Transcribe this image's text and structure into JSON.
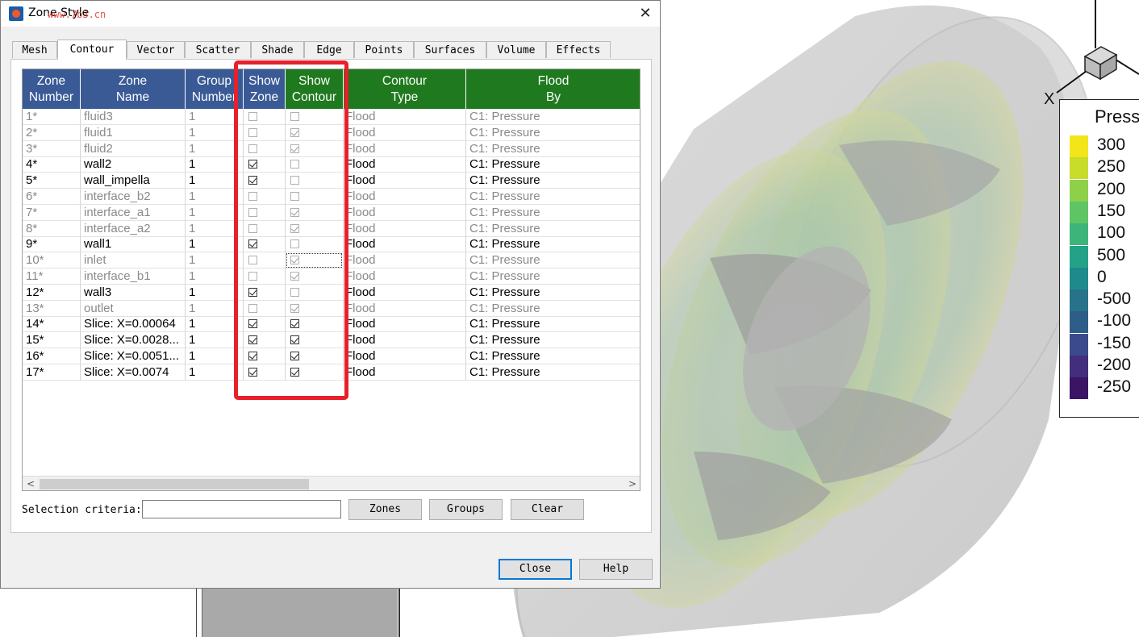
{
  "dialog": {
    "title": "Zone Style",
    "watermark": "www.7b3.cn",
    "close_glyph": "✕"
  },
  "tabs": [
    {
      "label": "Mesh",
      "active": false
    },
    {
      "label": "Contour",
      "active": true
    },
    {
      "label": "Vector",
      "active": false
    },
    {
      "label": "Scatter",
      "active": false
    },
    {
      "label": "Shade",
      "active": false
    },
    {
      "label": "Edge",
      "active": false
    },
    {
      "label": "Points",
      "active": false
    },
    {
      "label": "Surfaces",
      "active": false
    },
    {
      "label": "Volume",
      "active": false
    },
    {
      "label": "Effects",
      "active": false
    }
  ],
  "grid": {
    "headers": {
      "zone_number": [
        "Zone",
        "Number"
      ],
      "zone_name": [
        "Zone",
        "Name"
      ],
      "group_number": [
        "Group",
        "Number"
      ],
      "show_zone": [
        "Show",
        "Zone"
      ],
      "show_contour": [
        "Show",
        "Contour"
      ],
      "contour_type": [
        "Contour",
        "Type"
      ],
      "flood_by": [
        "Flood",
        "By"
      ]
    },
    "rows": [
      {
        "num": "1*",
        "name": "fluid3",
        "group": "1",
        "show_zone": false,
        "show_contour": false,
        "type": "Flood",
        "flood_by": "C1: Pressure",
        "active": false
      },
      {
        "num": "2*",
        "name": "fluid1",
        "group": "1",
        "show_zone": false,
        "show_contour": true,
        "type": "Flood",
        "flood_by": "C1: Pressure",
        "active": false
      },
      {
        "num": "3*",
        "name": "fluid2",
        "group": "1",
        "show_zone": false,
        "show_contour": true,
        "type": "Flood",
        "flood_by": "C1: Pressure",
        "active": false
      },
      {
        "num": "4*",
        "name": "wall2",
        "group": "1",
        "show_zone": true,
        "show_contour": false,
        "type": "Flood",
        "flood_by": "C1: Pressure",
        "active": true
      },
      {
        "num": "5*",
        "name": "wall_impella",
        "group": "1",
        "show_zone": true,
        "show_contour": false,
        "type": "Flood",
        "flood_by": "C1: Pressure",
        "active": true
      },
      {
        "num": "6*",
        "name": "interface_b2",
        "group": "1",
        "show_zone": false,
        "show_contour": false,
        "type": "Flood",
        "flood_by": "C1: Pressure",
        "active": false
      },
      {
        "num": "7*",
        "name": "interface_a1",
        "group": "1",
        "show_zone": false,
        "show_contour": true,
        "type": "Flood",
        "flood_by": "C1: Pressure",
        "active": false
      },
      {
        "num": "8*",
        "name": "interface_a2",
        "group": "1",
        "show_zone": false,
        "show_contour": true,
        "type": "Flood",
        "flood_by": "C1: Pressure",
        "active": false
      },
      {
        "num": "9*",
        "name": "wall1",
        "group": "1",
        "show_zone": true,
        "show_contour": false,
        "type": "Flood",
        "flood_by": "C1: Pressure",
        "active": true
      },
      {
        "num": "10*",
        "name": "inlet",
        "group": "1",
        "show_zone": false,
        "show_contour": true,
        "type": "Flood",
        "flood_by": "C1: Pressure",
        "active": false,
        "focused": true
      },
      {
        "num": "11*",
        "name": "interface_b1",
        "group": "1",
        "show_zone": false,
        "show_contour": true,
        "type": "Flood",
        "flood_by": "C1: Pressure",
        "active": false
      },
      {
        "num": "12*",
        "name": "wall3",
        "group": "1",
        "show_zone": true,
        "show_contour": false,
        "type": "Flood",
        "flood_by": "C1: Pressure",
        "active": true
      },
      {
        "num": "13*",
        "name": "outlet",
        "group": "1",
        "show_zone": false,
        "show_contour": true,
        "type": "Flood",
        "flood_by": "C1: Pressure",
        "active": false
      },
      {
        "num": "14*",
        "name": "Slice: X=0.00064",
        "group": "1",
        "show_zone": true,
        "show_contour": true,
        "type": "Flood",
        "flood_by": "C1: Pressure",
        "active": true
      },
      {
        "num": "15*",
        "name": "Slice: X=0.0028...",
        "group": "1",
        "show_zone": true,
        "show_contour": true,
        "type": "Flood",
        "flood_by": "C1: Pressure",
        "active": true
      },
      {
        "num": "16*",
        "name": "Slice: X=0.0051...",
        "group": "1",
        "show_zone": true,
        "show_contour": true,
        "type": "Flood",
        "flood_by": "C1: Pressure",
        "active": true
      },
      {
        "num": "17*",
        "name": "Slice: X=0.0074",
        "group": "1",
        "show_zone": true,
        "show_contour": true,
        "type": "Flood",
        "flood_by": "C1: Pressure",
        "active": true
      }
    ]
  },
  "scrollbar": {
    "left_glyph": "<",
    "right_glyph": ">"
  },
  "selection": {
    "label": "Selection criteria:",
    "value": "",
    "zones_label": "Zones",
    "groups_label": "Groups",
    "clear_label": "Clear"
  },
  "footer": {
    "close_label": "Close",
    "help_label": "Help"
  },
  "legend": {
    "title": "Press",
    "labels": [
      "300",
      "250",
      "200",
      "150",
      "100",
      "500",
      "0",
      "-500",
      "-100",
      "-150",
      "-200",
      "-250"
    ],
    "colors": [
      "#f2e51a",
      "#c8dc2a",
      "#8ed04a",
      "#5fc463",
      "#3db47a",
      "#23a287",
      "#1f8a8c",
      "#277389",
      "#2f5d8a",
      "#3a4a8c",
      "#432e7e",
      "#3c1466"
    ]
  },
  "axis": {
    "x_label": "X"
  },
  "colors": {
    "header_blue": "#3a5a96",
    "header_green": "#1f7a1f",
    "highlight_red": "#e8202a"
  }
}
